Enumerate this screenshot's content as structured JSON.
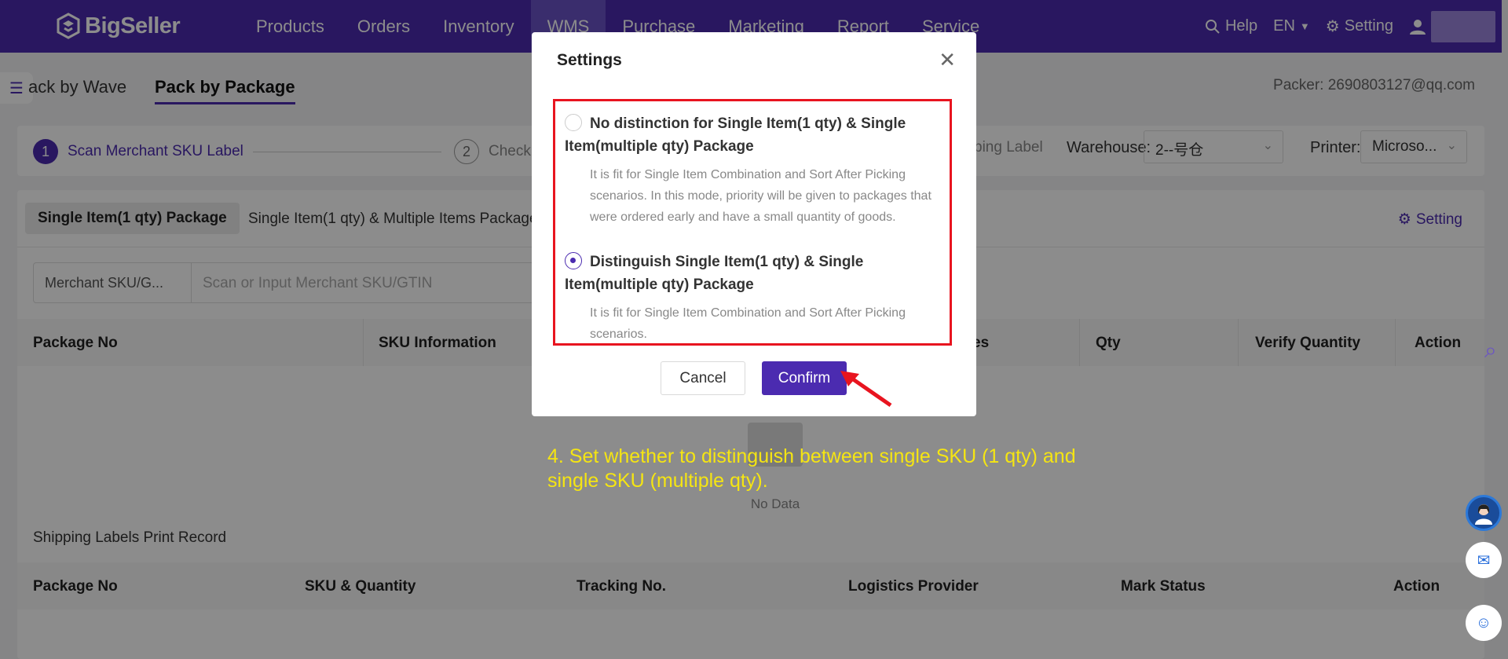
{
  "nav": {
    "brand": "BigSeller",
    "items": [
      "Products",
      "Orders",
      "Inventory",
      "WMS",
      "Purchase",
      "Marketing",
      "Report",
      "Service"
    ],
    "help": "Help",
    "lang": "EN",
    "setting": "Setting"
  },
  "page": {
    "tab_wave": "ack by Wave",
    "tab_package": "Pack by Package",
    "packer": "Packer: 2690803127@qq.com"
  },
  "steps": {
    "step1_num": "1",
    "step1_label": "Scan Merchant SKU Label",
    "step2_num": "2",
    "step2_label": "Check",
    "step3_label": "ping Label",
    "warehouse_label": "Warehouse:",
    "warehouse_value": "2--号仓",
    "printer_label": "Printer:",
    "printer_value": "Microso..."
  },
  "main": {
    "subtab_single": "Single Item(1 qty) Package",
    "subtab_multi": "Single Item(1 qty) & Multiple Items Package",
    "setting_link": "Setting",
    "scan_select": "Merchant SKU/G...",
    "scan_placeholder": "Scan or Input Merchant SKU/GTIN",
    "columns": [
      "Package No",
      "SKU Information",
      "es",
      "Qty",
      "Verify Quantity",
      "Action"
    ],
    "no_data": "No Data",
    "print_record_title": "Shipping Labels Print Record",
    "print_columns": [
      "Package No",
      "SKU & Quantity",
      "Tracking No.",
      "Logistics Provider",
      "Mark Status",
      "Action"
    ]
  },
  "modal": {
    "title": "Settings",
    "option1_label": "No distinction for Single Item(1 qty) & Single Item(multiple qty) Package",
    "option1_desc": "It is fit for Single Item Combination and Sort After Picking scenarios. In this mode, priority will be given to packages that were ordered early and have a small quantity of goods.",
    "option2_label": "Distinguish Single Item(1 qty) & Single Item(multiple qty) Package",
    "option2_desc": "It is fit for Single Item Combination and Sort After Picking scenarios.",
    "selected_option": 2,
    "cancel": "Cancel",
    "confirm": "Confirm"
  },
  "annotation": {
    "caption": "4. Set whether to distinguish between single SKU (1 qty) and single SKU (multiple qty).",
    "highlight_color": "#e8141f",
    "caption_color": "#f5e512"
  },
  "colors": {
    "brand": "#4b2bb0"
  }
}
